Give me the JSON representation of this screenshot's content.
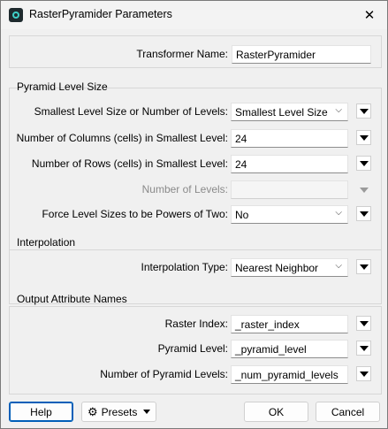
{
  "window": {
    "title": "RasterPyramider Parameters",
    "close_glyph": "✕"
  },
  "transformer": {
    "label": "Transformer Name:",
    "value": "RasterPyramider"
  },
  "pyramid_level_size": {
    "title": "Pyramid Level Size",
    "smallest_level": {
      "label": "Smallest Level Size or Number of Levels:",
      "value": "Smallest Level Size"
    },
    "columns": {
      "label": "Number of Columns (cells) in Smallest Level:",
      "value": "24"
    },
    "rows": {
      "label": "Number of Rows (cells) in Smallest Level:",
      "value": "24"
    },
    "num_levels": {
      "label": "Number of Levels:",
      "value": ""
    },
    "powers_of_two": {
      "label": "Force Level Sizes to be Powers of Two:",
      "value": "No"
    }
  },
  "interpolation": {
    "title": "Interpolation",
    "type": {
      "label": "Interpolation Type:",
      "value": "Nearest Neighbor"
    }
  },
  "output_attributes": {
    "title": "Output Attribute Names",
    "raster_index": {
      "label": "Raster Index:",
      "value": "_raster_index"
    },
    "pyramid_level": {
      "label": "Pyramid Level:",
      "value": "_pyramid_level"
    },
    "num_pyramid_levels": {
      "label": "Number of Pyramid Levels:",
      "value": "_num_pyramid_levels"
    }
  },
  "footer": {
    "help": "Help",
    "presets": "Presets",
    "ok": "OK",
    "cancel": "Cancel"
  },
  "icons": {
    "dropdown": "chevron-down-icon",
    "menu": "triangle-down-icon",
    "presets": "gear-icon"
  }
}
